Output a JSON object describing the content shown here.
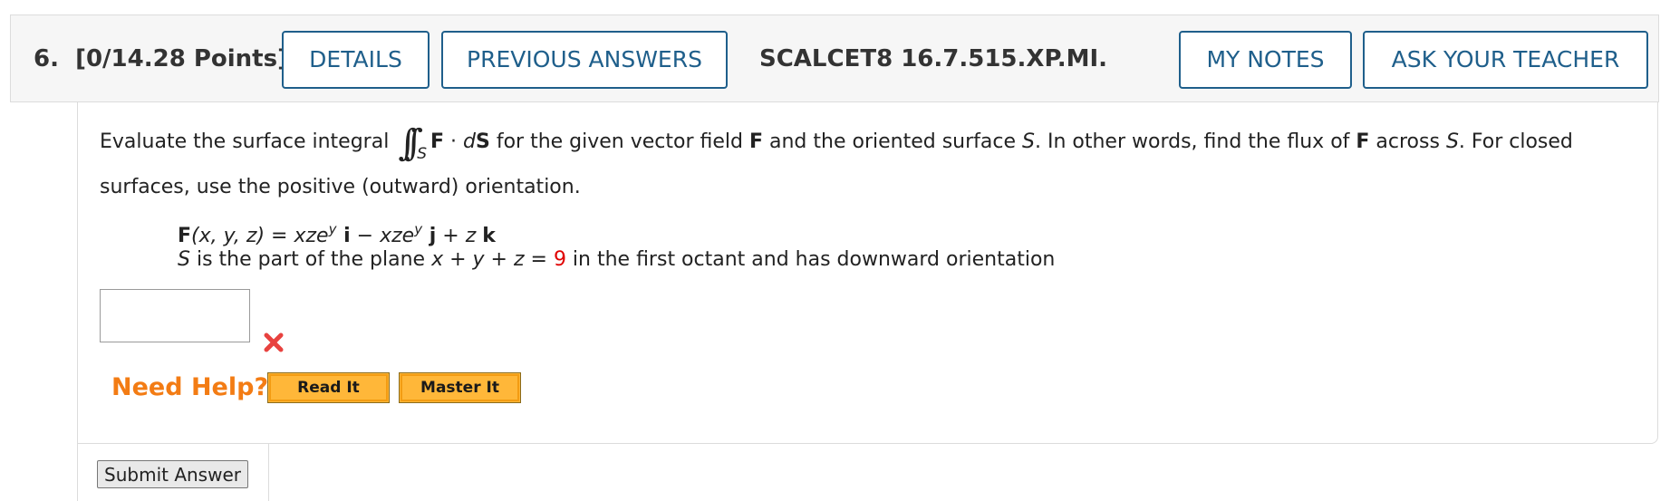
{
  "header": {
    "question_number": "6.",
    "points": "[0/14.28 Points]",
    "details_label": "DETAILS",
    "previous_answers_label": "PREVIOUS ANSWERS",
    "problem_code": "SCALCET8 16.7.515.XP.MI.",
    "my_notes_label": "MY NOTES",
    "ask_teacher_label": "ASK YOUR TEACHER"
  },
  "question": {
    "intro_1": "Evaluate the surface integral",
    "integral_symbol": "∫∫",
    "integral_sub": "S",
    "integrand_F": "F",
    "integrand_dot": " · ",
    "integrand_d": "d",
    "integrand_S": "S",
    "intro_2": " for the given vector field ",
    "intro_F": "F",
    "intro_3": " and the oriented surface ",
    "intro_S": "S",
    "intro_4": ". In other words, find the flux of ",
    "intro_F2": "F",
    "intro_5": " across ",
    "intro_S2": "S",
    "intro_6": ". For closed surfaces, use the positive (outward) orientation.",
    "field_F": "F",
    "field_args": "(x, y, z) = xze",
    "field_exp1": "y",
    "field_i": " i",
    "field_minus": " − xze",
    "field_exp2": "y",
    "field_j": " j",
    "field_plus": " + z ",
    "field_k": "k",
    "surface_S": "S",
    "surface_text_1": " is the part of the plane ",
    "surface_eq": "x + y + z = ",
    "surface_value": "9",
    "surface_text_2": " in the first octant and has downward orientation"
  },
  "answer": {
    "value": "",
    "status_icon": "incorrect-x-icon",
    "status_color": "#e8423f"
  },
  "help": {
    "label": "Need Help?",
    "read_it_label": "Read It",
    "master_it_label": "Master It",
    "color": "#f37c14"
  },
  "submit": {
    "label": "Submit Answer"
  },
  "colors": {
    "accent": "#1f5f8b",
    "help_button": "#ffb739",
    "highlight_value": "#e00000"
  }
}
